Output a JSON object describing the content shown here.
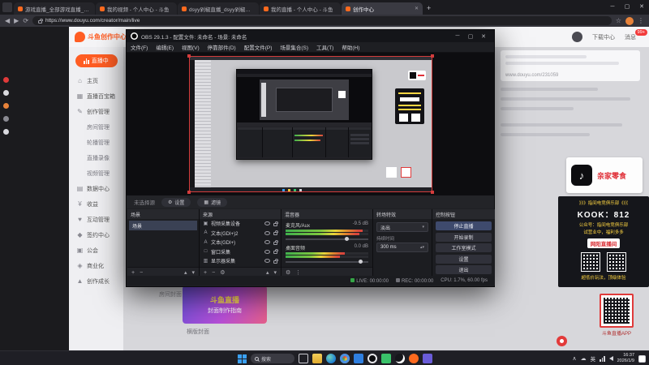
{
  "browser": {
    "tabs": [
      {
        "label": "游戏直播_全部游戏直播_斗鱼直播"
      },
      {
        "label": "我的视频 - 个人中心 - 斗鱼"
      },
      {
        "label": "dsyy剁椒直播_dsyy剁椒直播_dsy..."
      },
      {
        "label": "我的直播 - 个人中心 - 斗鱼"
      },
      {
        "label": "创作中心"
      }
    ],
    "url": "https://www.douyu.com/creator/main/live"
  },
  "page": {
    "logo": "斗鱼创作中心",
    "header": {
      "download": "下载中心",
      "messages": "消息",
      "badge": "99+"
    },
    "live_button": "直播中",
    "sidebar": [
      {
        "label": "主页"
      },
      {
        "label": "直播百宝箱"
      },
      {
        "label": "创作管理"
      },
      {
        "label": "房间管理"
      },
      {
        "label": "轮播管理"
      },
      {
        "label": "直播录像"
      },
      {
        "label": "视频管理"
      },
      {
        "label": "数据中心"
      },
      {
        "label": "收益"
      },
      {
        "label": "互动管理"
      },
      {
        "label": "签约中心"
      },
      {
        "label": "公会"
      },
      {
        "label": "商业化"
      },
      {
        "label": "创作成长"
      }
    ],
    "right": {
      "room_url": "www.douyu.com/231059",
      "snack_label": "亲家零食",
      "promo_title": "》》》指间电竞俱乐部《《《",
      "kook": "KOOK：812",
      "gongzhonghao": "公众号：指间电竞俱乐部",
      "promo_line1": "试营业中，福利多多",
      "promo_line2": "超低价玩法，顶级体验",
      "room_badge": "网阳直播间",
      "qr_caption": "斗鱼直播APP"
    },
    "bottom": {
      "cover_label": "房间封面",
      "banner_line1": "斗鱼直播",
      "banner_line2": "封面制作指南",
      "cover_type": "横版封面"
    }
  },
  "obs": {
    "title": "OBS 29.1.3 - 配置文件: 未命名 - 场景: 未命名",
    "menus": [
      "文件(F)",
      "编辑(E)",
      "视图(V)",
      "停靠部件(D)",
      "配置文件(P)",
      "场景集合(S)",
      "工具(T)",
      "帮助(H)"
    ],
    "no_source": "未选择源",
    "props_button": "设置",
    "filters_button": "滤镜",
    "docks": {
      "scenes": {
        "title": "场景",
        "items": [
          {
            "label": "场景"
          }
        ]
      },
      "sources": {
        "title": "来源",
        "items": [
          {
            "label": "视频采集设备"
          },
          {
            "label": "文本(GDI+)2"
          },
          {
            "label": "文本(GDI+)"
          },
          {
            "label": "窗口采集"
          },
          {
            "label": "显示器采集"
          }
        ]
      },
      "mixer": {
        "title": "混音器",
        "channels": [
          {
            "name": "麦克风/Aux",
            "db": "-9.5 dB"
          },
          {
            "name": "桌面音频",
            "db": "0.0 dB"
          }
        ]
      },
      "transitions": {
        "title": "转场特效",
        "selected": "淡出",
        "duration_label": "持续时间",
        "duration": "300 ms"
      },
      "controls": {
        "title": "控制按钮",
        "buttons": [
          "停止直播",
          "开始录制",
          "工作室模式",
          "设置",
          "退出"
        ]
      }
    },
    "status": {
      "live": "LIVE: 00:00:00",
      "rec": "REC: 00:00:00",
      "cpu": "CPU: 1.7%, 60.00 fps"
    }
  },
  "taskbar": {
    "search": "搜索",
    "ime": "英",
    "time": "16:37",
    "date": "2026/1/9"
  }
}
